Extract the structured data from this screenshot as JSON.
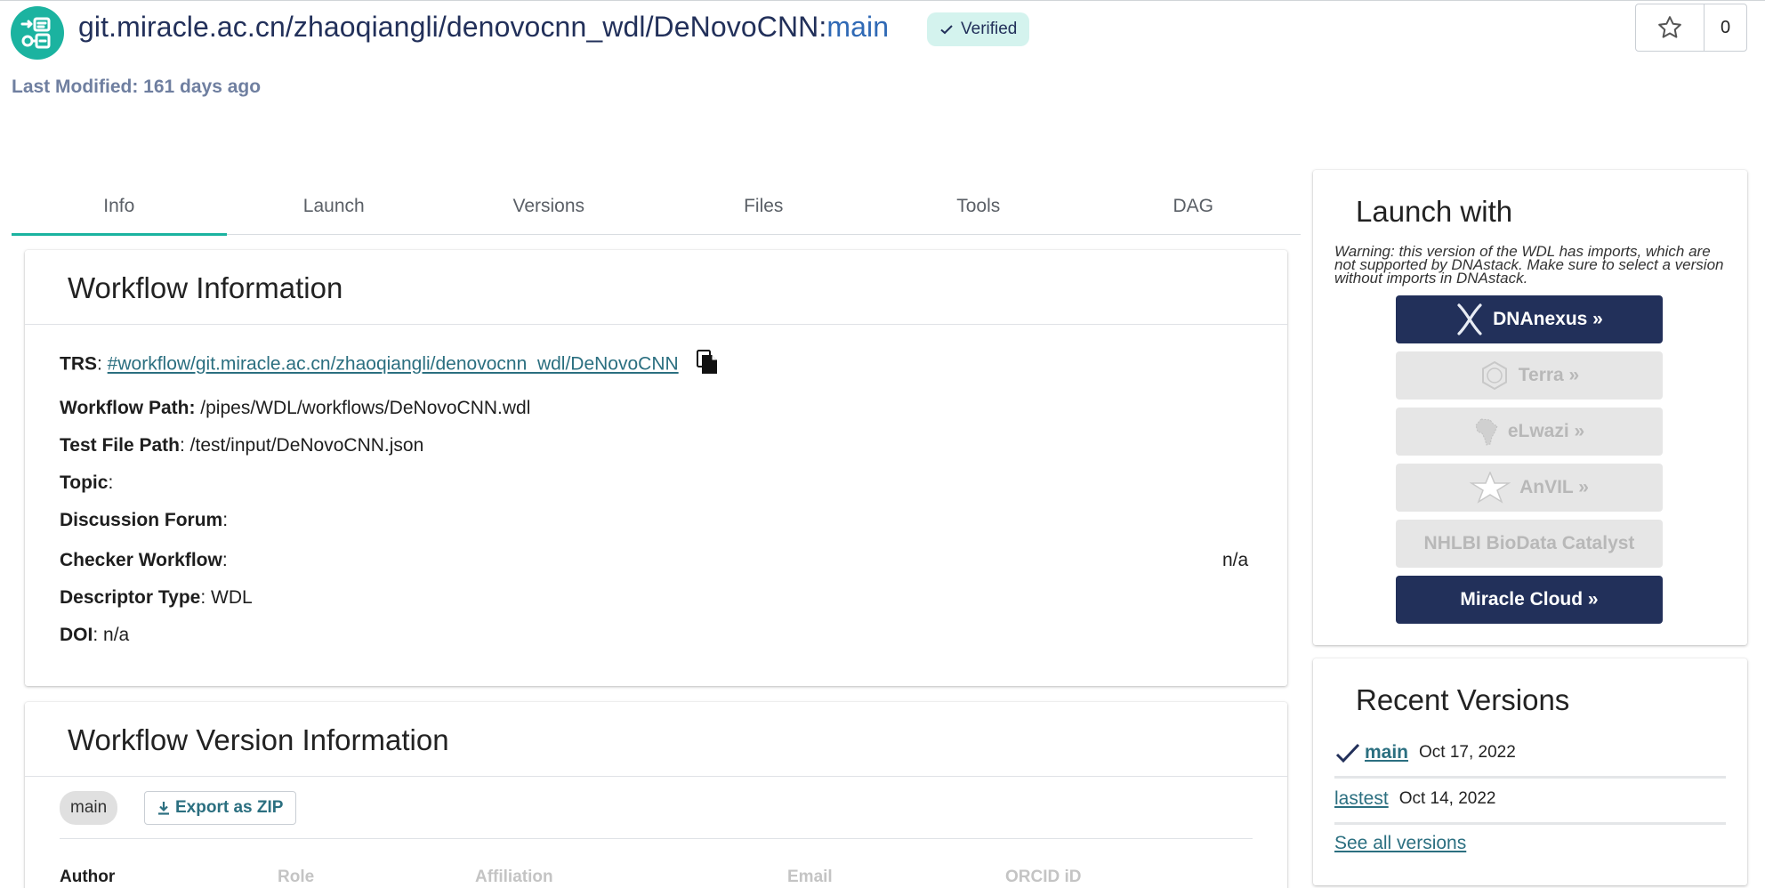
{
  "header": {
    "repo_path": "git.miracle.ac.cn/zhaoqiangli/denovocnn_wdl/DeNovoCNN",
    "separator": ":",
    "branch": "main",
    "verified_label": "Verified",
    "last_modified": "Last Modified: 161 days ago",
    "star_count": "0"
  },
  "tabs": [
    {
      "label": "Info",
      "active": true
    },
    {
      "label": "Launch"
    },
    {
      "label": "Versions"
    },
    {
      "label": "Files"
    },
    {
      "label": "Tools"
    },
    {
      "label": "DAG"
    }
  ],
  "workflow_info": {
    "title": "Workflow Information",
    "trs_label": "TRS",
    "trs_value": "#workflow/git.miracle.ac.cn/zhaoqiangli/denovocnn_wdl/DeNovoCNN",
    "workflow_path_label": "Workflow Path:",
    "workflow_path_value": "/pipes/WDL/workflows/DeNovoCNN.wdl",
    "test_file_label": "Test File Path",
    "test_file_value": "/test/input/DeNovoCNN.json",
    "topic_label": "Topic",
    "topic_value": "",
    "forum_label": "Discussion Forum",
    "forum_value": "",
    "checker_label": "Checker Workflow",
    "checker_value": "n/a",
    "descriptor_label": "Descriptor Type",
    "descriptor_value": "WDL",
    "doi_label": "DOI",
    "doi_value": "n/a"
  },
  "version_info": {
    "title": "Workflow Version Information",
    "version_chip": "main",
    "export_label": "Export as ZIP",
    "table_headers": [
      "Author",
      "Role",
      "Affiliation",
      "Email",
      "ORCID iD"
    ]
  },
  "launch_with": {
    "title": "Launch with",
    "warning": "Warning: this version of the WDL has imports, which are not supported by DNAstack. Make sure to select a version without imports in DNAstack.",
    "buttons": [
      {
        "label": "DNAnexus »",
        "state": "enabled",
        "icon": "dnanexus-icon"
      },
      {
        "label": "Terra »",
        "state": "disabled",
        "icon": "terra-icon"
      },
      {
        "label": "eLwazi »",
        "state": "disabled",
        "icon": "africa-map-icon"
      },
      {
        "label": "AnVIL »",
        "state": "disabled",
        "icon": "anvil-star-icon"
      },
      {
        "label": "NHLBI BioData Catalyst",
        "state": "disabled",
        "icon": ""
      },
      {
        "label": "Miracle Cloud »",
        "state": "enabled",
        "icon": ""
      }
    ]
  },
  "recent_versions": {
    "title": "Recent Versions",
    "items": [
      {
        "name": "main",
        "date": "Oct 17, 2022",
        "verified": true
      },
      {
        "name": "lastest",
        "date": "Oct 14, 2022",
        "verified": false
      }
    ],
    "see_all": "See all versions"
  },
  "colors": {
    "brand_teal": "#1bb3a0",
    "navy": "#22305a",
    "link": "#2b6f80",
    "verified_bg": "#d4f3ee"
  }
}
